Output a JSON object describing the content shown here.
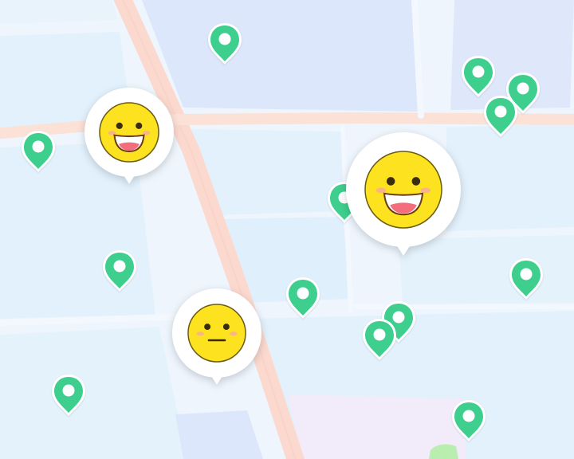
{
  "map": {
    "pin_icon": "map-pin-icon",
    "pin_color": "#3ecf8e",
    "colors": {
      "background": "#eef5fd",
      "block_light": "#e2f1fc",
      "block_blue": "#dce7fb",
      "road": "#fbd9cf",
      "park": "#f1ebfa",
      "green": "#b9eeb0"
    },
    "pins": [
      {
        "id": "pin-1"
      },
      {
        "id": "pin-2"
      },
      {
        "id": "pin-3"
      },
      {
        "id": "pin-4"
      },
      {
        "id": "pin-5"
      },
      {
        "id": "pin-6"
      },
      {
        "id": "pin-7"
      },
      {
        "id": "pin-8"
      },
      {
        "id": "pin-9"
      },
      {
        "id": "pin-10"
      },
      {
        "id": "pin-11"
      },
      {
        "id": "pin-12"
      },
      {
        "id": "pin-13"
      },
      {
        "id": "pin-14"
      }
    ],
    "emoji_markers": [
      {
        "id": "happy-small",
        "face": "grinning-face-icon"
      },
      {
        "id": "happy-large",
        "face": "grinning-face-icon"
      },
      {
        "id": "neutral",
        "face": "neutral-face-icon"
      }
    ]
  }
}
